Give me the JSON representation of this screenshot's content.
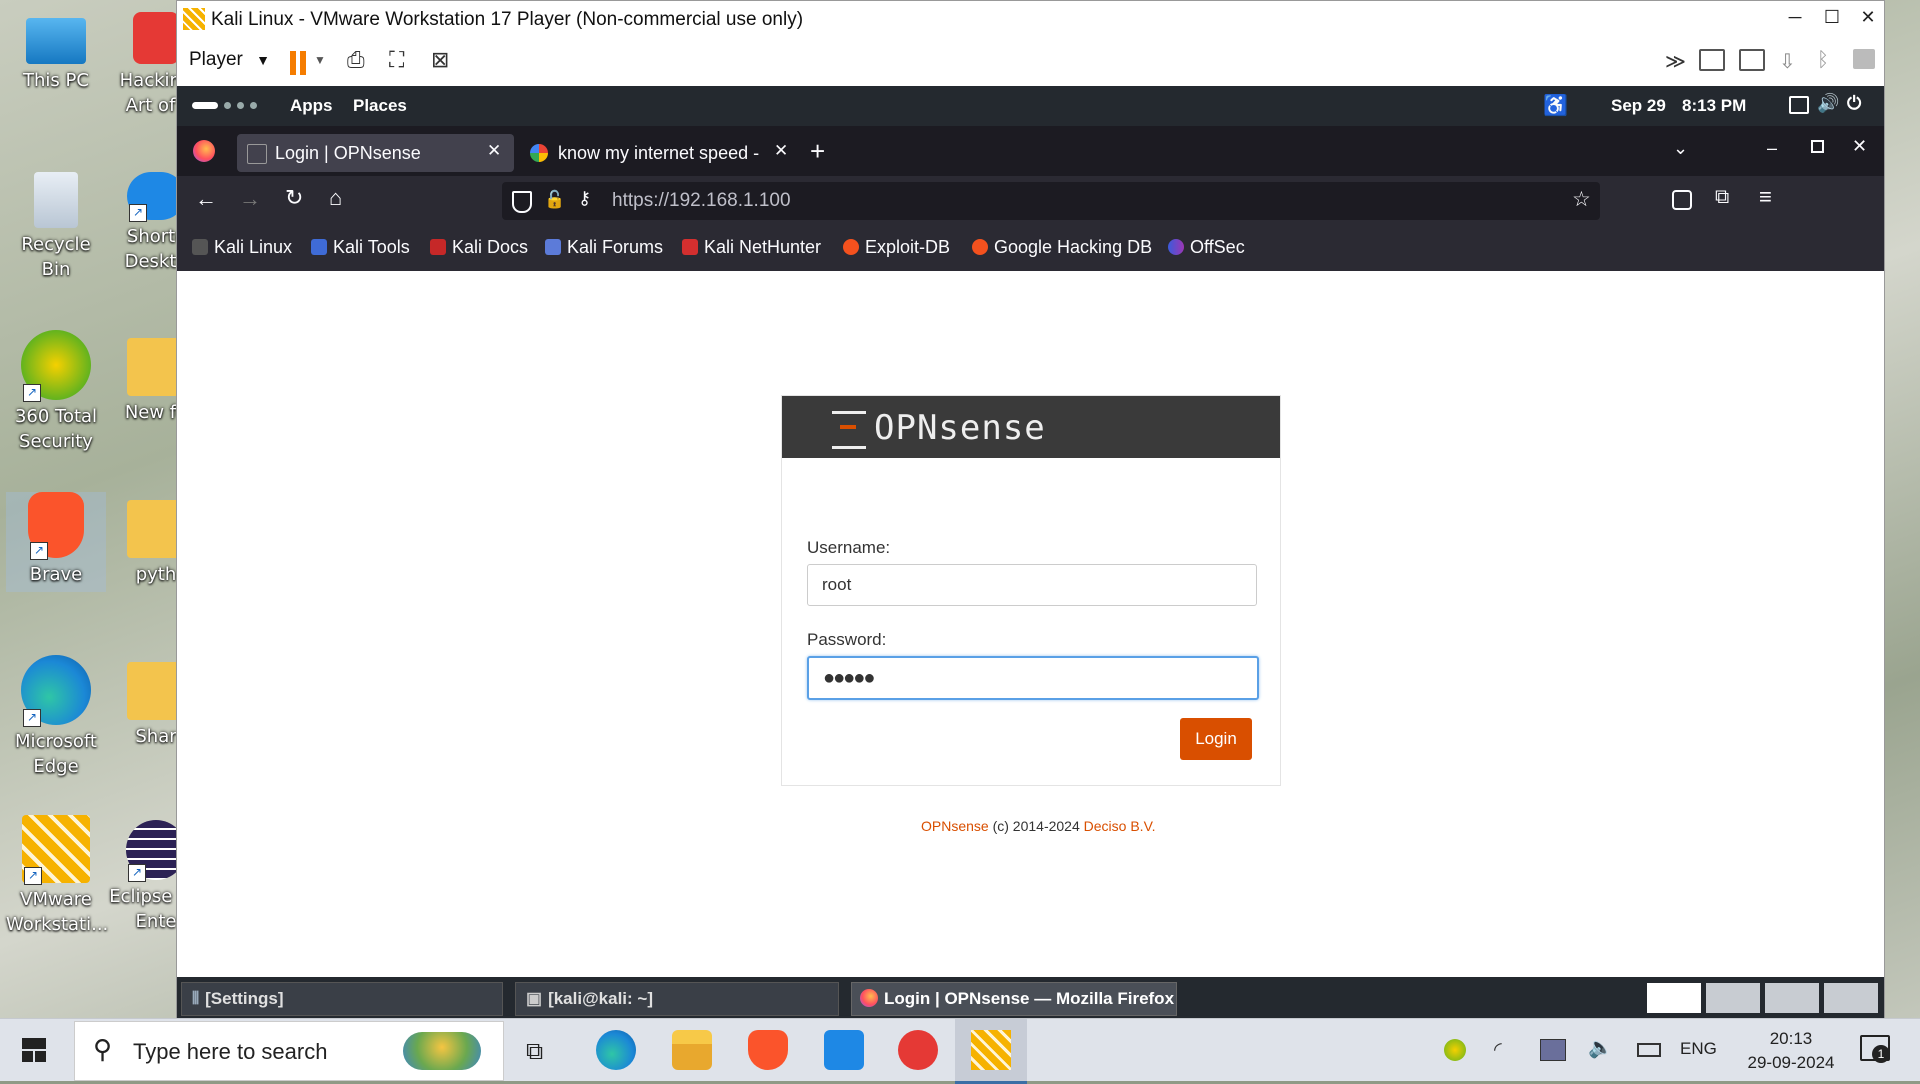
{
  "desktop": {
    "icons": [
      {
        "label": "This PC"
      },
      {
        "label": "Hacking Art of I"
      },
      {
        "label": "Recycle Bin"
      },
      {
        "label": "Shortc Deskto"
      },
      {
        "label": "360 Total Security"
      },
      {
        "label": "New fo"
      },
      {
        "label": "Brave"
      },
      {
        "label": "pyth"
      },
      {
        "label": "Microsoft Edge"
      },
      {
        "label": "Shar"
      },
      {
        "label": "VMware Workstati..."
      },
      {
        "label": "Eclipse for Ente"
      }
    ]
  },
  "vmware": {
    "title": "Kali Linux - VMware Workstation 17 Player (Non-commercial use only)",
    "player_menu": "Player"
  },
  "gnome_panel": {
    "apps": "Apps",
    "places": "Places",
    "date": "Sep 29",
    "time": "8:13 PM"
  },
  "firefox": {
    "tabs": [
      {
        "label": "Login | OPNsense"
      },
      {
        "label": "know my internet speed -"
      }
    ],
    "url": "https://192.168.1.100",
    "bookmarks": [
      {
        "label": "Kali Linux"
      },
      {
        "label": "Kali Tools"
      },
      {
        "label": "Kali Docs"
      },
      {
        "label": "Kali Forums"
      },
      {
        "label": "Kali NetHunter"
      },
      {
        "label": "Exploit-DB"
      },
      {
        "label": "Google Hacking DB"
      },
      {
        "label": "OffSec"
      }
    ]
  },
  "login": {
    "logo_text": "OPNsense",
    "username_label": "Username:",
    "username_value": "root",
    "password_label": "Password:",
    "password_value": "●●●●●",
    "button": "Login",
    "footer_brand": "OPNsense",
    "footer_copy": "(c) 2014-2024",
    "footer_company": "Deciso B.V."
  },
  "kali_taskbar": {
    "items": [
      {
        "label": "[Settings]"
      },
      {
        "label": "[kali@kali: ~]"
      },
      {
        "label": "Login | OPNsense — Mozilla Firefox"
      }
    ]
  },
  "windows_taskbar": {
    "search_placeholder": "Type here to search",
    "lang": "ENG",
    "time": "20:13",
    "date": "29-09-2024",
    "notification_count": "1"
  },
  "colors": {
    "accent": "#d94f00",
    "panel": "#24292f",
    "firefox_toolbar": "#2b2a33"
  }
}
